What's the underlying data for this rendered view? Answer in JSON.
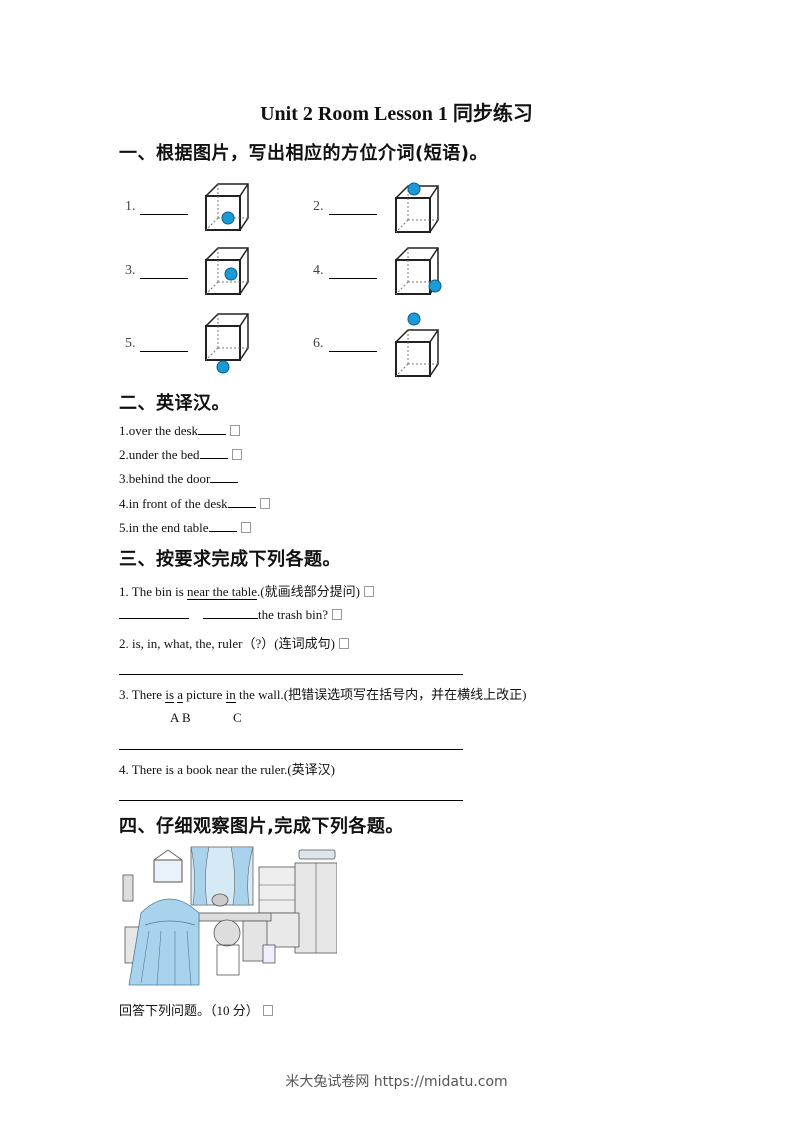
{
  "title": "Unit 2 Room Lesson 1 同步练习",
  "section1": {
    "heading": "一、根据图片，写出相应的方位介词(短语)。",
    "items": [
      {
        "num": "1.",
        "ball_position": "in-bottom-right"
      },
      {
        "num": "2.",
        "ball_position": "on-top"
      },
      {
        "num": "3.",
        "ball_position": "in-middle"
      },
      {
        "num": "4.",
        "ball_position": "beside-bottom-right"
      },
      {
        "num": "5.",
        "ball_position": "under"
      },
      {
        "num": "6.",
        "ball_position": "above"
      }
    ],
    "ball_color": "#1a9ad6"
  },
  "section2": {
    "heading": "二、英译汉。",
    "items": [
      {
        "text": "1.over the desk",
        "has_box": true
      },
      {
        "text": "2.under the bed",
        "has_box": true
      },
      {
        "text": "3.behind the door",
        "has_box": false
      },
      {
        "text": "4.in front of the desk",
        "has_box": true
      },
      {
        "text": "5.in the end table",
        "has_box": true
      }
    ]
  },
  "section3": {
    "heading": "三、按要求完成下列各题。",
    "q1": {
      "prefix": "1. The bin is ",
      "underlined": "near the table",
      "suffix": ".(就画线部分提问)"
    },
    "q1_answer_tail": "the trash bin?",
    "q2": "2. is, in, what, the, ruler（?）(连词成句)",
    "q3": {
      "p1": "3. There ",
      "u1": "is",
      "p2": " ",
      "u2": "a",
      "p3": " picture ",
      "u3": "in",
      "p4": " the wall.(把错误选项写在括号内，并在横线上改正)"
    },
    "q3_labels": {
      "a": "A",
      "b": "B",
      "c": "C"
    },
    "q4": "4. There is a book near the ruler.(英译汉)"
  },
  "section4": {
    "heading": "四、仔细观察图片,完成下列各题。",
    "image_alt": "bedroom illustration",
    "instruction": "回答下列问题。（10 分）"
  },
  "footer": "米大兔试卷网 https://midatu.com"
}
